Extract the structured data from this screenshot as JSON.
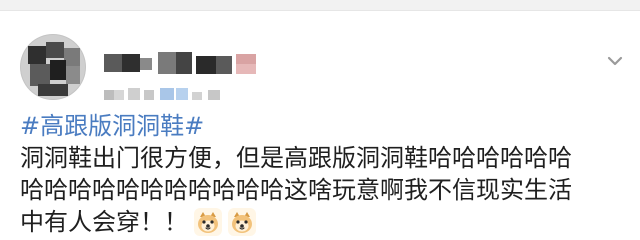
{
  "post": {
    "hashtag": "#高跟版洞洞鞋#",
    "lines": [
      "洞洞鞋出门很方便，但是高跟版洞洞鞋哈哈哈哈哈哈",
      "哈哈哈哈哈哈哈哈哈哈哈这啥玩意啊我不信现实生活",
      "中有人会穿！！"
    ],
    "emojis": [
      "doge-emoji",
      "doge-emoji"
    ]
  },
  "icons": {
    "dropdown": "chevron-down-icon"
  },
  "colors": {
    "link": "#4a7cc1",
    "text": "#1f1f1f",
    "background": "#ffffff"
  }
}
